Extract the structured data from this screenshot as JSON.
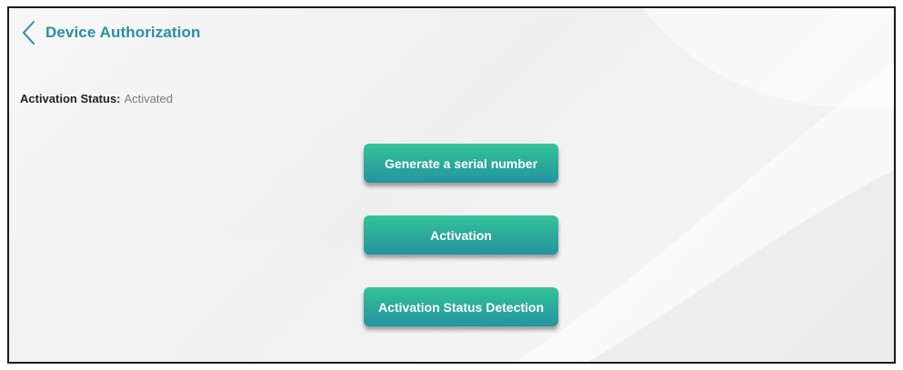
{
  "header": {
    "title": "Device Authorization",
    "back_icon": "chevron-left-icon"
  },
  "status": {
    "label": "Activation Status:",
    "value": "Activated"
  },
  "buttons": {
    "generate_label": "Generate a serial number",
    "activation_label": "Activation",
    "detection_label": "Activation Status Detection"
  },
  "colors": {
    "accent": "#2a8fa3",
    "button_top": "#35c39a",
    "button_bottom": "#2494a2"
  }
}
